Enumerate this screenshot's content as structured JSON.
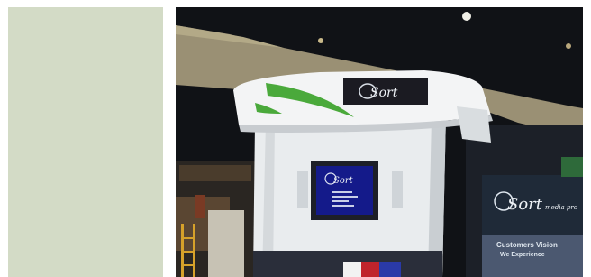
{
  "photo": {
    "kiosk_logo_text": "Sort",
    "banner_logo_text": "Sort",
    "banner_logo_suffix": "media pro",
    "banner_line1": "Customers Vision",
    "banner_line2": "We Experience"
  },
  "colors": {
    "left_panel": "#d3dbc6",
    "kiosk_white": "#eceff1",
    "accent_green": "#49a83a",
    "screen_blue": "#141a8a"
  }
}
